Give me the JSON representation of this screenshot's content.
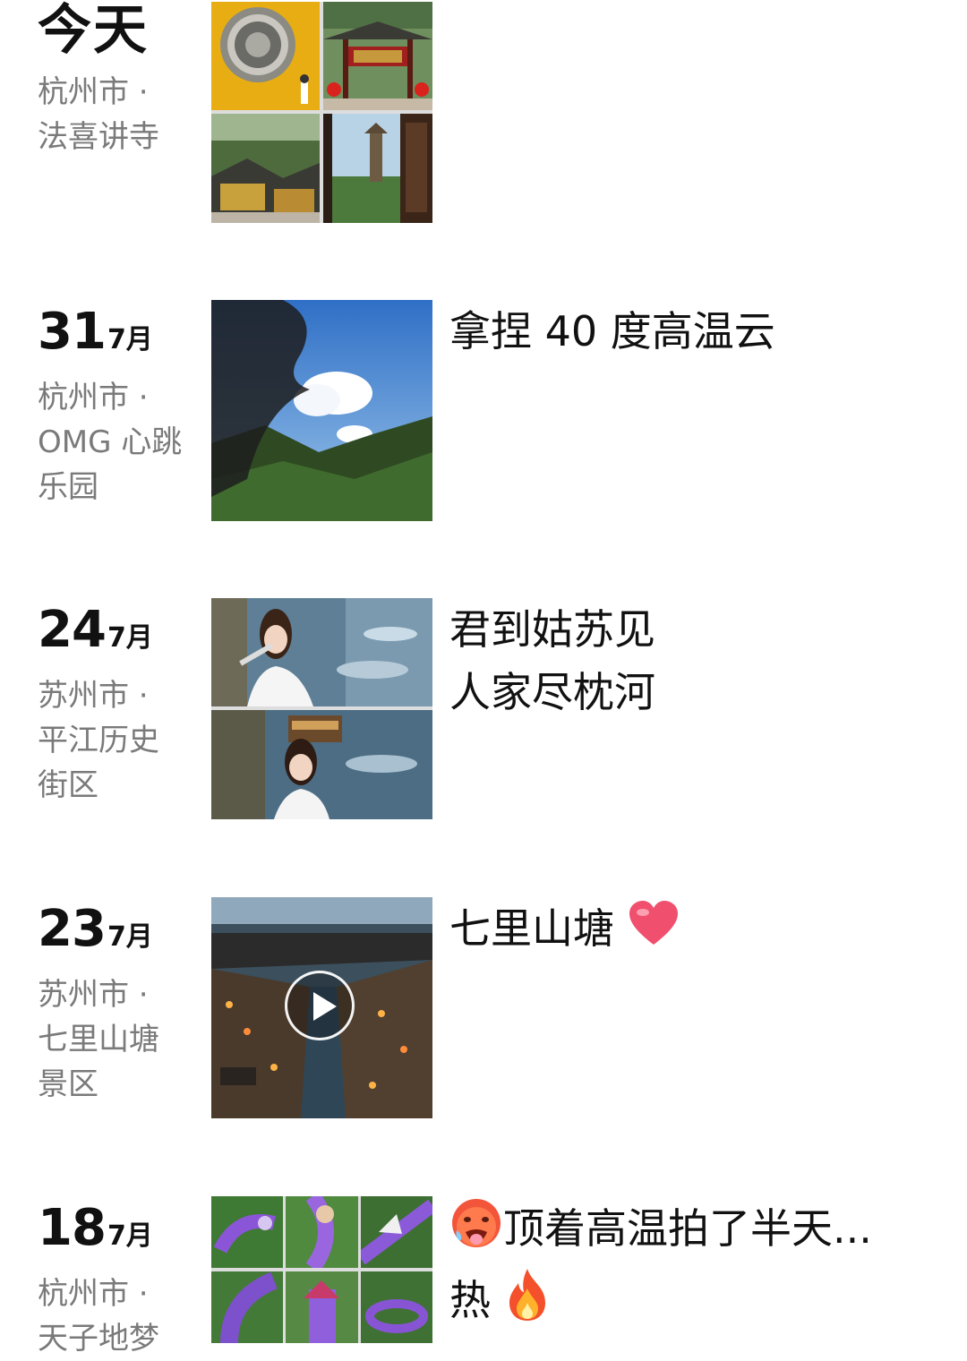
{
  "posts": [
    {
      "day_big": "今天",
      "month": "",
      "location_lines": [
        "杭州市 ·",
        "法喜讲寺"
      ],
      "caption_lines": [],
      "media_type": "4-grid",
      "media_descriptions": [
        "round-carved-stone-medallion-on-yellow-wall",
        "temple-gate-with-red-lanterns",
        "temple-rooftops-among-trees",
        "pagoda-view-through-window"
      ]
    },
    {
      "day_big": "31",
      "month": "7月",
      "location_lines": [
        "杭州市 ·",
        "OMG 心跳",
        "乐园"
      ],
      "caption_lines": [
        "拿捏 40 度高温云"
      ],
      "media_type": "single",
      "media_descriptions": [
        "hand-pinching-cloud-blue-sky"
      ]
    },
    {
      "day_big": "24",
      "month": "7月",
      "location_lines": [
        "苏州市 ·",
        "平江历史",
        "街区"
      ],
      "caption_lines": [
        "君到姑苏见",
        "人家尽枕河"
      ],
      "media_type": "2-stack",
      "media_descriptions": [
        "woman-by-canal-with-fan",
        "woman-by-canal-with-boat"
      ]
    },
    {
      "day_big": "23",
      "month": "7月",
      "location_lines": [
        "苏州市 ·",
        "七里山塘",
        "景区"
      ],
      "caption_lines": [
        "七里山塘"
      ],
      "caption_emoji": "heart",
      "media_type": "video",
      "media_descriptions": [
        "aerial-canal-street-at-dusk"
      ]
    },
    {
      "day_big": "18",
      "month": "7月",
      "location_lines": [
        "杭州市 ·",
        "天子地梦"
      ],
      "caption_lines": [
        "顶着高温拍了半天...",
        "热"
      ],
      "caption_emoji": "hot-face-and-fire",
      "media_type": "9-grid",
      "media_descriptions": [
        "purple-dragon-sculpture-aerial"
      ]
    }
  ],
  "colors": {
    "location_gray": "#7a7a7a",
    "text_black": "#111111",
    "heart_red": "#f0506e"
  }
}
